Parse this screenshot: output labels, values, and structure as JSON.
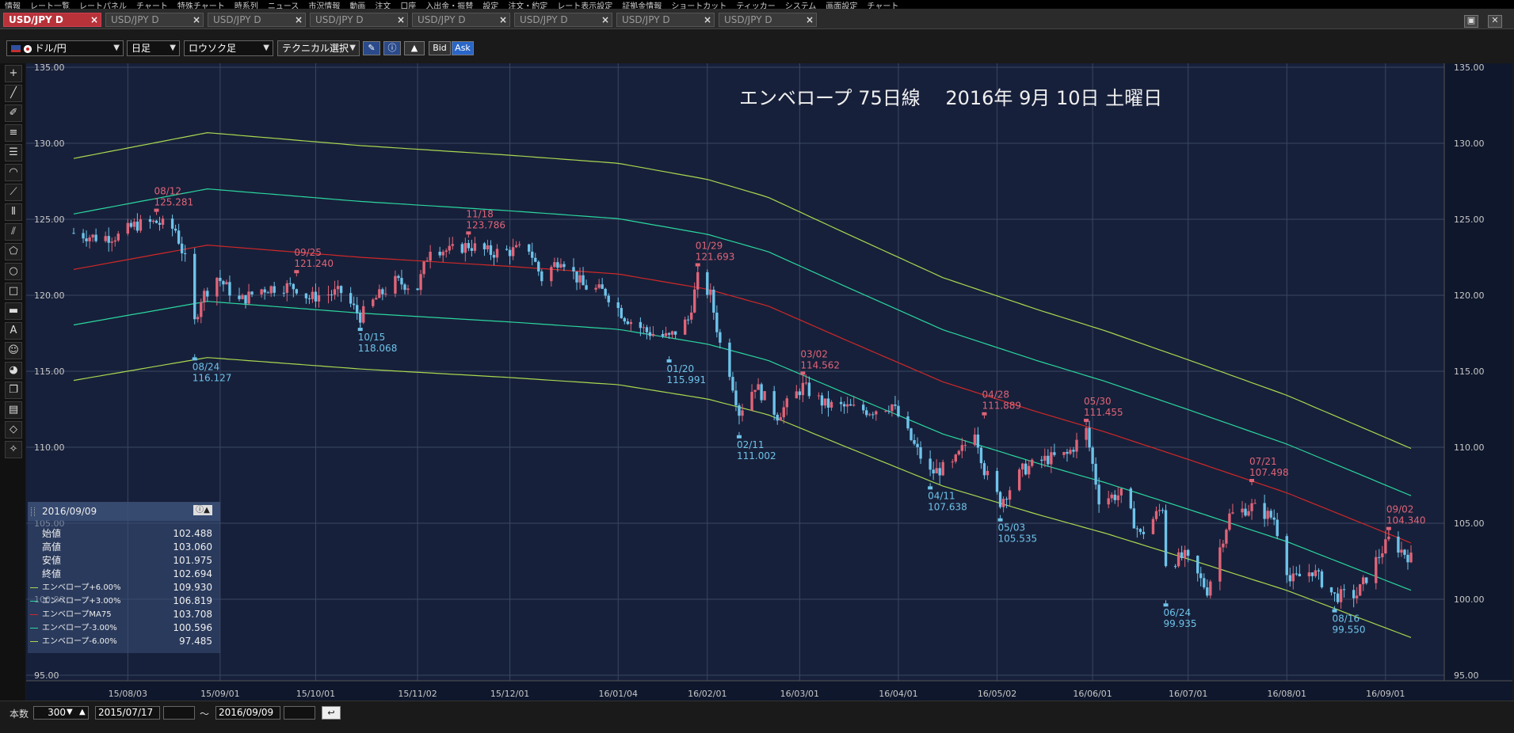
{
  "menu": {
    "items": [
      "情報",
      "レート一覧",
      "レートパネル",
      "チャート",
      "特殊チャート",
      "時系列",
      "ニュース",
      "市況情報",
      "動画",
      "注文",
      "口座",
      "入出金・振替",
      "設定",
      "注文・約定",
      "レート表示設定",
      "証拠金情報",
      "ショートカット",
      "ティッカー",
      "システム",
      "画面設定",
      "チャート"
    ]
  },
  "tabs": [
    {
      "label": "USD/JPY D",
      "active": true
    },
    {
      "label": "USD/JPY D",
      "active": false
    },
    {
      "label": "USD/JPY D",
      "active": false
    },
    {
      "label": "USD/JPY D",
      "active": false
    },
    {
      "label": "USD/JPY D",
      "active": false
    },
    {
      "label": "USD/JPY D",
      "active": false
    },
    {
      "label": "USD/JPY D",
      "active": false
    },
    {
      "label": "USD/JPY D",
      "active": false
    }
  ],
  "tab_close": "×",
  "toolbar": {
    "currency": "ドル/円",
    "period": "日足",
    "chart_type": "ロウソク足",
    "technical": "テクニカル選択",
    "bid": "Bid",
    "ask": "Ask"
  },
  "colors": {
    "bg": "#17203a",
    "grid": "#3a4660",
    "up": "#e06478",
    "down": "#6ec3ea",
    "env6": "#a8d850",
    "env3": "#2ad7a0",
    "ma": "#d02828",
    "high_label": "#e06478",
    "low_label": "#6ec3ea",
    "axis_text": "#c8c8c8"
  },
  "ohlc": {
    "date": "2016/09/09",
    "rows": [
      {
        "label": "始値",
        "value": "102.488"
      },
      {
        "label": "高値",
        "value": "103.060"
      },
      {
        "label": "安値",
        "value": "101.975"
      },
      {
        "label": "終値",
        "value": "102.694"
      }
    ],
    "lines": [
      {
        "label": "エンベロープ+6.00%",
        "value": "109.930",
        "color": "#a8d850"
      },
      {
        "label": "エンベロープ+3.00%",
        "value": "106.819",
        "color": "#2ad7a0"
      },
      {
        "label": "エンベロープMA75",
        "value": "103.708",
        "color": "#d02828"
      },
      {
        "label": "エンベロープ-3.00%",
        "value": "100.596",
        "color": "#2ad7a0"
      },
      {
        "label": "エンベロープ-6.00%",
        "value": "97.485",
        "color": "#a8d850"
      }
    ]
  },
  "bottom": {
    "count_label": "本数",
    "count_value": "300",
    "from": "2015/07/17",
    "tilde": "〜",
    "to": "2016/09/09"
  },
  "chart_data": {
    "type": "candlestick",
    "title": "エンベロープ 75日線　 2016年 9月 10日 土曜日",
    "ylim": [
      95,
      135
    ],
    "yticks": [
      "95.00",
      "100.00",
      "105.00",
      "110.00",
      "115.00",
      "120.00",
      "125.00",
      "130.00",
      "135.00"
    ],
    "x_range": [
      "2015-07-17",
      "2016-09-09"
    ],
    "xticks": [
      {
        "date": "2015-08-03",
        "label": "15/08/03"
      },
      {
        "date": "2015-09-01",
        "label": "15/09/01"
      },
      {
        "date": "2015-10-01",
        "label": "15/10/01"
      },
      {
        "date": "2015-11-02",
        "label": "15/11/02"
      },
      {
        "date": "2015-12-01",
        "label": "15/12/01"
      },
      {
        "date": "2016-01-04",
        "label": "16/01/04"
      },
      {
        "date": "2016-02-01",
        "label": "16/02/01"
      },
      {
        "date": "2016-03-01",
        "label": "16/03/01"
      },
      {
        "date": "2016-04-01",
        "label": "16/04/01"
      },
      {
        "date": "2016-05-02",
        "label": "16/05/02"
      },
      {
        "date": "2016-06-01",
        "label": "16/06/01"
      },
      {
        "date": "2016-07-01",
        "label": "16/07/01"
      },
      {
        "date": "2016-08-01",
        "label": "16/08/01"
      },
      {
        "date": "2016-09-01",
        "label": "16/09/01"
      }
    ],
    "close_points": [
      [
        "2015-07-17",
        124.1
      ],
      [
        "2015-07-24",
        123.8
      ],
      [
        "2015-07-31",
        123.9
      ],
      [
        "2015-08-05",
        124.6
      ],
      [
        "2015-08-12",
        124.8
      ],
      [
        "2015-08-18",
        124.3
      ],
      [
        "2015-08-21",
        122.3
      ],
      [
        "2015-08-24",
        118.2
      ],
      [
        "2015-08-26",
        119.8
      ],
      [
        "2015-08-31",
        121.2
      ],
      [
        "2015-09-07",
        119.6
      ],
      [
        "2015-09-14",
        120.4
      ],
      [
        "2015-09-21",
        120.6
      ],
      [
        "2015-09-25",
        120.5
      ],
      [
        "2015-09-29",
        119.8
      ],
      [
        "2015-10-02",
        120.0
      ],
      [
        "2015-10-09",
        120.2
      ],
      [
        "2015-10-15",
        118.6
      ],
      [
        "2015-10-20",
        119.8
      ],
      [
        "2015-10-26",
        120.9
      ],
      [
        "2015-11-02",
        120.5
      ],
      [
        "2015-11-06",
        123.2
      ],
      [
        "2015-11-12",
        122.9
      ],
      [
        "2015-11-18",
        123.3
      ],
      [
        "2015-11-25",
        122.8
      ],
      [
        "2015-12-01",
        122.9
      ],
      [
        "2015-12-07",
        123.1
      ],
      [
        "2015-12-11",
        121.1
      ],
      [
        "2015-12-17",
        122.5
      ],
      [
        "2015-12-24",
        120.6
      ],
      [
        "2015-12-31",
        120.2
      ],
      [
        "2016-01-06",
        118.6
      ],
      [
        "2016-01-13",
        117.6
      ],
      [
        "2016-01-20",
        117.2
      ],
      [
        "2016-01-26",
        118.4
      ],
      [
        "2016-01-29",
        121.1
      ],
      [
        "2016-02-02",
        120.0
      ],
      [
        "2016-02-05",
        116.8
      ],
      [
        "2016-02-08",
        115.0
      ],
      [
        "2016-02-11",
        112.3
      ],
      [
        "2016-02-16",
        114.1
      ],
      [
        "2016-02-23",
        112.1
      ],
      [
        "2016-03-02",
        114.0
      ],
      [
        "2016-03-09",
        112.8
      ],
      [
        "2016-03-16",
        112.6
      ],
      [
        "2016-03-23",
        112.4
      ],
      [
        "2016-03-30",
        112.8
      ],
      [
        "2016-04-06",
        110.1
      ],
      [
        "2016-04-11",
        108.3
      ],
      [
        "2016-04-18",
        108.8
      ],
      [
        "2016-04-25",
        111.2
      ],
      [
        "2016-04-28",
        108.5
      ],
      [
        "2016-05-03",
        106.4
      ],
      [
        "2016-05-10",
        108.5
      ],
      [
        "2016-05-17",
        109.2
      ],
      [
        "2016-05-24",
        109.5
      ],
      [
        "2016-05-30",
        111.1
      ],
      [
        "2016-06-03",
        106.6
      ],
      [
        "2016-06-10",
        106.9
      ],
      [
        "2016-06-16",
        104.2
      ],
      [
        "2016-06-23",
        106.1
      ],
      [
        "2016-06-24",
        102.4
      ],
      [
        "2016-06-30",
        102.8
      ],
      [
        "2016-07-07",
        100.6
      ],
      [
        "2016-07-14",
        105.5
      ],
      [
        "2016-07-21",
        106.1
      ],
      [
        "2016-07-28",
        105.3
      ],
      [
        "2016-08-02",
        101.2
      ],
      [
        "2016-08-09",
        101.9
      ],
      [
        "2016-08-16",
        100.2
      ],
      [
        "2016-08-23",
        100.3
      ],
      [
        "2016-08-30",
        102.9
      ],
      [
        "2016-09-02",
        103.9
      ],
      [
        "2016-09-09",
        102.7
      ]
    ],
    "ma75": [
      [
        "2015-07-17",
        121.7
      ],
      [
        "2015-08-28",
        123.3
      ],
      [
        "2015-10-15",
        122.5
      ],
      [
        "2015-12-01",
        121.9
      ],
      [
        "2016-01-04",
        121.4
      ],
      [
        "2016-02-01",
        120.4
      ],
      [
        "2016-02-20",
        119.3
      ],
      [
        "2016-03-15",
        117.1
      ],
      [
        "2016-04-15",
        114.3
      ],
      [
        "2016-05-15",
        112.3
      ],
      [
        "2016-06-05",
        111.0
      ],
      [
        "2016-07-01",
        109.2
      ],
      [
        "2016-08-01",
        107.0
      ],
      [
        "2016-09-09",
        103.7
      ]
    ],
    "series": [
      {
        "name": "エンベロープ+6.00%",
        "k": 1.06,
        "color": "#a8d850"
      },
      {
        "name": "エンベロープ+3.00%",
        "k": 1.03,
        "color": "#2ad7a0"
      },
      {
        "name": "エンベロープMA75",
        "k": 1.0,
        "color": "#d02828"
      },
      {
        "name": "エンベロープ-3.00%",
        "k": 0.97,
        "color": "#2ad7a0"
      },
      {
        "name": "エンベロープ-6.00%",
        "k": 0.94,
        "color": "#a8d850"
      }
    ],
    "annotations": [
      {
        "date": "2015-08-12",
        "value": 125.281,
        "kind": "high",
        "text1": "08/12",
        "text2": "125.281"
      },
      {
        "date": "2015-08-24",
        "value": 116.127,
        "kind": "low",
        "text1": "08/24",
        "text2": "116.127"
      },
      {
        "date": "2015-09-25",
        "value": 121.24,
        "kind": "high",
        "text1": "09/25",
        "text2": "121.240"
      },
      {
        "date": "2015-10-15",
        "value": 118.068,
        "kind": "low",
        "text1": "10/15",
        "text2": "118.068"
      },
      {
        "date": "2015-11-18",
        "value": 123.786,
        "kind": "high",
        "text1": "11/18",
        "text2": "123.786"
      },
      {
        "date": "2016-01-20",
        "value": 115.991,
        "kind": "low",
        "text1": "01/20",
        "text2": "115.991"
      },
      {
        "date": "2016-01-29",
        "value": 121.693,
        "kind": "high",
        "text1": "01/29",
        "text2": "121.693"
      },
      {
        "date": "2016-02-11",
        "value": 111.002,
        "kind": "low",
        "text1": "02/11",
        "text2": "111.002"
      },
      {
        "date": "2016-03-02",
        "value": 114.562,
        "kind": "high",
        "text1": "03/02",
        "text2": "114.562"
      },
      {
        "date": "2016-04-11",
        "value": 107.638,
        "kind": "low",
        "text1": "04/11",
        "text2": "107.638"
      },
      {
        "date": "2016-04-28",
        "value": 111.889,
        "kind": "high",
        "text1": "04/28",
        "text2": "111.889"
      },
      {
        "date": "2016-05-03",
        "value": 105.535,
        "kind": "low",
        "text1": "05/03",
        "text2": "105.535"
      },
      {
        "date": "2016-05-30",
        "value": 111.455,
        "kind": "high",
        "text1": "05/30",
        "text2": "111.455"
      },
      {
        "date": "2016-06-24",
        "value": 99.935,
        "kind": "low",
        "text1": "06/24",
        "text2": "99.935"
      },
      {
        "date": "2016-07-21",
        "value": 107.498,
        "kind": "high",
        "text1": "07/21",
        "text2": "107.498"
      },
      {
        "date": "2016-08-16",
        "value": 99.55,
        "kind": "low",
        "text1": "08/16",
        "text2": "99.550"
      },
      {
        "date": "2016-09-02",
        "value": 104.34,
        "kind": "high",
        "text1": "09/02",
        "text2": "104.340"
      }
    ]
  }
}
